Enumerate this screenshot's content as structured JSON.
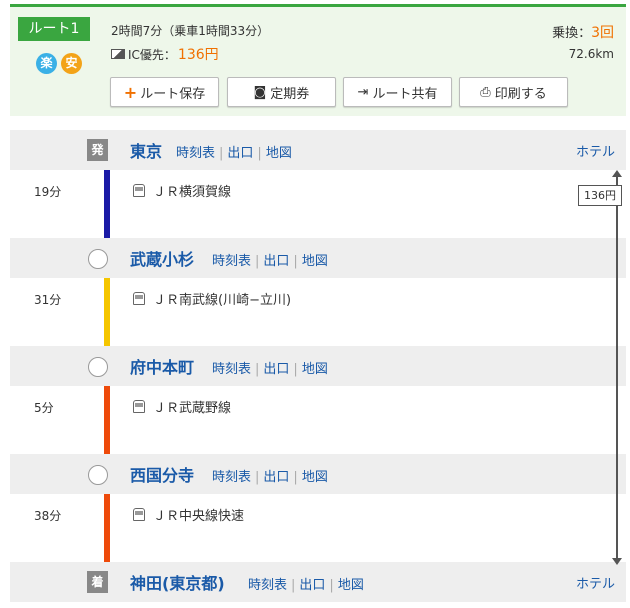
{
  "route": {
    "badge": "ルート1",
    "tags": [
      "楽",
      "安"
    ],
    "time_summary": "2時間7分（乗車1時間33分）",
    "ic_label": "IC優先：",
    "fare": "136円",
    "transfer_label": "乗換：",
    "transfer_count": "3回",
    "distance": "72.6km"
  },
  "actions": {
    "save": "ルート保存",
    "pass": "定期券",
    "share": "ルート共有",
    "print": "印刷する"
  },
  "links": {
    "timetable": "時刻表",
    "exit": "出口",
    "map": "地図",
    "hotel": "ホテル"
  },
  "marks": {
    "depart": "発",
    "arrive": "着"
  },
  "stations": [
    {
      "name": "東京"
    },
    {
      "name": "武蔵小杉"
    },
    {
      "name": "府中本町"
    },
    {
      "name": "西国分寺"
    },
    {
      "name": "神田(東京都)"
    }
  ],
  "segments": [
    {
      "duration": "19分",
      "line": "ＪＲ横須賀線",
      "color": "#1a1aa6"
    },
    {
      "duration": "31分",
      "line": "ＪＲ南武線(川崎−立川)",
      "color": "#f5c600"
    },
    {
      "duration": "5分",
      "line": "ＪＲ武蔵野線",
      "color": "#ee4a0a"
    },
    {
      "duration": "38分",
      "line": "ＪＲ中央線快速",
      "color": "#ee4a0a"
    }
  ],
  "fare_marker": "136円",
  "colors": {
    "accent": "#3aa640",
    "fare": "#f07000",
    "link": "#1a5aa8"
  }
}
